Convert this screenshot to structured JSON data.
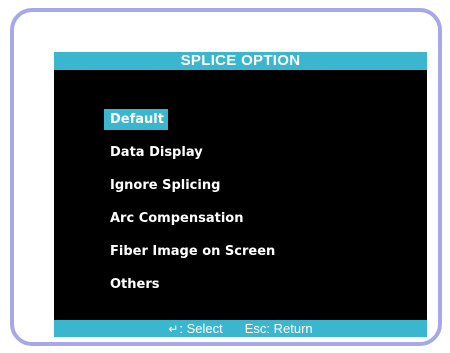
{
  "screen": {
    "title": "SPLICE OPTION",
    "menu": [
      {
        "label": "Default",
        "selected": true
      },
      {
        "label": "Data Display",
        "selected": false
      },
      {
        "label": "Ignore Splicing",
        "selected": false
      },
      {
        "label": "Arc Compensation",
        "selected": false
      },
      {
        "label": "Fiber Image on Screen",
        "selected": false
      },
      {
        "label": "Others",
        "selected": false
      }
    ],
    "status": {
      "enter_icon": "↵",
      "select_label": ": Select",
      "return_label": "Esc: Return"
    }
  },
  "colors": {
    "accent": "#3bb6cf",
    "frame_border": "#a7a7ea",
    "screen_bg": "#000000"
  }
}
